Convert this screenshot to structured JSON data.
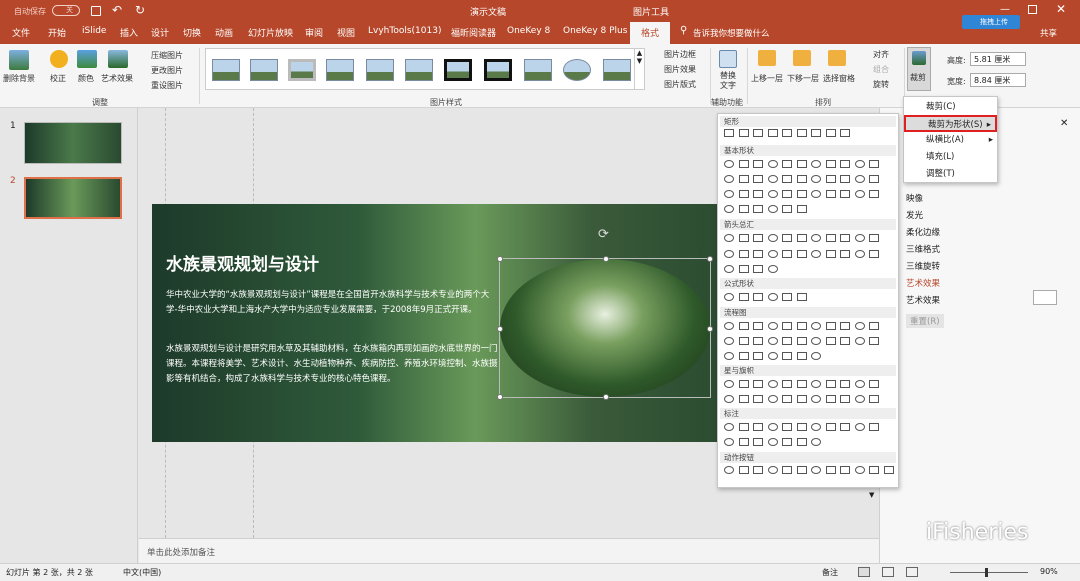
{
  "titlebar": {
    "autosave": "自动保存",
    "autosave_state": "关",
    "doc_title": "演示文稿",
    "picture_tools": "图片工具",
    "search_hint": "告诉我你想要做什么",
    "share": "共享",
    "upload_badge": "拖拽上传"
  },
  "tabs": [
    "文件",
    "开始",
    "iSlide",
    "插入",
    "设计",
    "切换",
    "动画",
    "幻灯片放映",
    "审阅",
    "视图",
    "LvyhTools(1013)",
    "福昕阅读器",
    "OneKey 8",
    "OneKey 8 Plus",
    "格式"
  ],
  "ribbon": {
    "remove_bg": "删除背景",
    "correct": "校正",
    "color": "颜色",
    "art_effect": "艺术效果",
    "compress": "压缩图片",
    "change": "更改图片",
    "reset": "重设图片",
    "group_adjust": "调整",
    "group_style": "图片样式",
    "border": "图片边框",
    "effect": "图片效果",
    "layout": "图片版式",
    "alt_text": "替换\n文字",
    "group_accessibility": "辅助功能",
    "bring_forward": "上移一层",
    "send_backward": "下移一层",
    "selection_pane": "选择窗格",
    "align": "对齐",
    "group": "组合",
    "rotate": "旋转",
    "group_arrange": "排列",
    "crop": "裁剪",
    "height_label": "高度:",
    "height_val": "5.81 厘米",
    "width_label": "宽度:",
    "width_val": "8.84 厘米"
  },
  "slides": [
    {
      "num": "1"
    },
    {
      "num": "2"
    }
  ],
  "slide": {
    "title": "水族景观规划与设计",
    "p1": "华中农业大学的“水族景观规划与设计”课程是在全国首开水族科学与技术专业的两个大学-华中农业大学和上海水产大学中为适应专业发展需要，于2008年9月正式开课。",
    "p2": "水族景观规划与设计是研究用水草及其辅助材料，在水族箱内再现如画的水底世界的一门课程。本课程将美学、艺术设计、水生动植物种养、疾病防控、养殖水环境控制、水族摄影等有机结合，构成了水族科学与技术专业的核心特色课程。"
  },
  "crop_menu": {
    "crop": "裁剪(C)",
    "crop_to_shape": "裁剪为形状(S)",
    "aspect": "纵横比(A)",
    "fill": "填充(L)",
    "fit": "调整(T)"
  },
  "shape_sections": [
    "矩形",
    "基本形状",
    "箭头总汇",
    "公式形状",
    "流程图",
    "星与旗帜",
    "标注",
    "动作按钮"
  ],
  "right_panel": {
    "items": [
      "映像",
      "发光",
      "柔化边缘",
      "三维格式",
      "三维旋转",
      "艺术效果",
      "艺术效果",
      "重置(R)"
    ]
  },
  "notes_placeholder": "单击此处添加备注",
  "status": {
    "slide_info": "幻灯片 第 2 张，共 2 张",
    "lang": "中文(中国)",
    "notes": "备注",
    "zoom": "90%"
  },
  "watermark": "iFisheries",
  "colors": {
    "accent": "#b7472a",
    "highlight": "#e02020"
  }
}
